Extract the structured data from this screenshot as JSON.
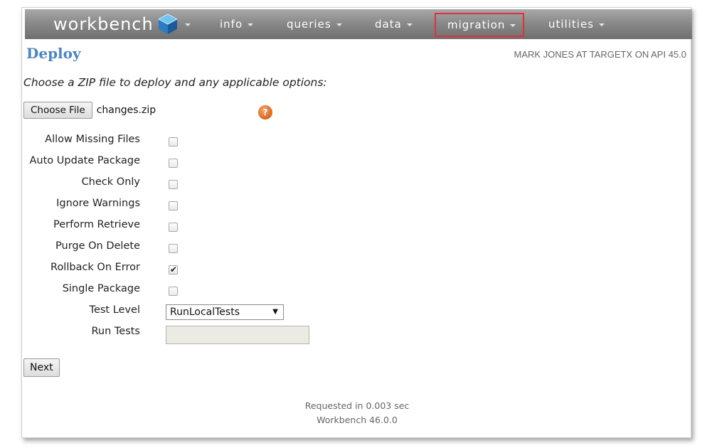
{
  "nav": {
    "brand": "workbench",
    "items": [
      {
        "label": "info"
      },
      {
        "label": "queries"
      },
      {
        "label": "data"
      },
      {
        "label": "migration",
        "highlighted": true
      },
      {
        "label": "utilities"
      }
    ],
    "highlight_color": "#e0303a"
  },
  "header": {
    "title": "Deploy",
    "user_info": "MARK JONES AT TARGETX ON API 45.0"
  },
  "form": {
    "instructions": "Choose a ZIP file to deploy and any applicable options:",
    "choose_file_label": "Choose File",
    "file_name": "changes.zip",
    "help_icon_glyph": "?",
    "options": [
      {
        "label": "Allow Missing Files",
        "checked": false
      },
      {
        "label": "Auto Update Package",
        "checked": false
      },
      {
        "label": "Check Only",
        "checked": false
      },
      {
        "label": "Ignore Warnings",
        "checked": false
      },
      {
        "label": "Perform Retrieve",
        "checked": false
      },
      {
        "label": "Purge On Delete",
        "checked": false
      },
      {
        "label": "Rollback On Error",
        "checked": true
      },
      {
        "label": "Single Package",
        "checked": false
      }
    ],
    "test_level_label": "Test Level",
    "test_level_value": "RunLocalTests",
    "run_tests_label": "Run Tests",
    "run_tests_value": "",
    "next_label": "Next"
  },
  "footer": {
    "timing": "Requested in 0.003 sec",
    "version": "Workbench 46.0.0"
  },
  "colors": {
    "title": "#4a86c5",
    "nav_text": "#ffffff",
    "help_icon": "#d9661e"
  }
}
